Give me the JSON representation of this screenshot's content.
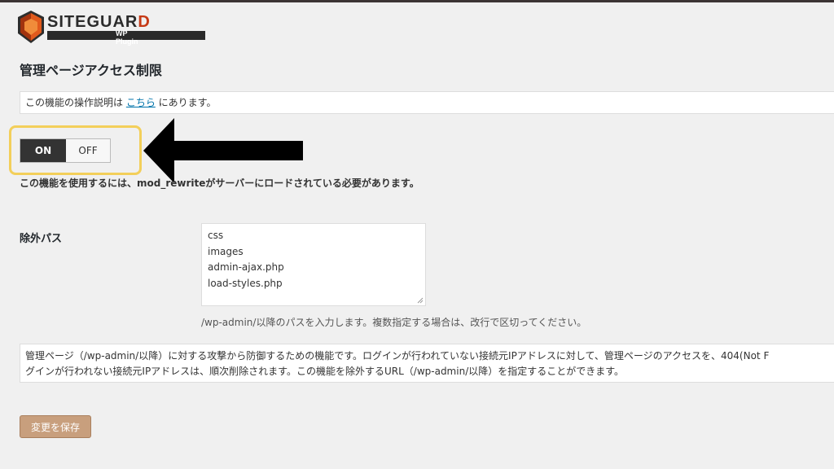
{
  "logo": {
    "text_main": "SITEGUAR",
    "text_accent": "D",
    "subtitle": "WP Plugin",
    "icon": "siteguard-shield-icon"
  },
  "page": {
    "title": "管理ページアクセス制限"
  },
  "notice": {
    "prefix": "この機能の操作説明は ",
    "link_text": "こちら",
    "suffix": " にあります。"
  },
  "toggle": {
    "on_label": "ON",
    "off_label": "OFF",
    "state": "ON"
  },
  "requirement_text": "この機能を使用するには、mod_rewriteがサーバーにロードされている必要があります。",
  "exclude": {
    "label": "除外パス",
    "paths": [
      "css",
      "images",
      "admin-ajax.php",
      "load-styles.php"
    ],
    "description": "/wp-admin/以降のパスを入力します。複数指定する場合は、改行で区切ってください。"
  },
  "description": {
    "line1": "管理ページ（/wp-admin/以降）に対する攻撃から防御するための機能です。ログインが行われていない接続元IPアドレスに対して、管理ページのアクセスを、404(Not F",
    "line2": "グインが行われない接続元IPアドレスは、順次削除されます。この機能を除外するURL（/wp-admin/以降）を指定することができます。"
  },
  "save_button": "変更を保存",
  "colors": {
    "highlight": "#f3cf5a",
    "link": "#0073aa",
    "save_button": "#c89f7d",
    "toggle_on": "#333333",
    "logo_accent": "#c63a16"
  }
}
